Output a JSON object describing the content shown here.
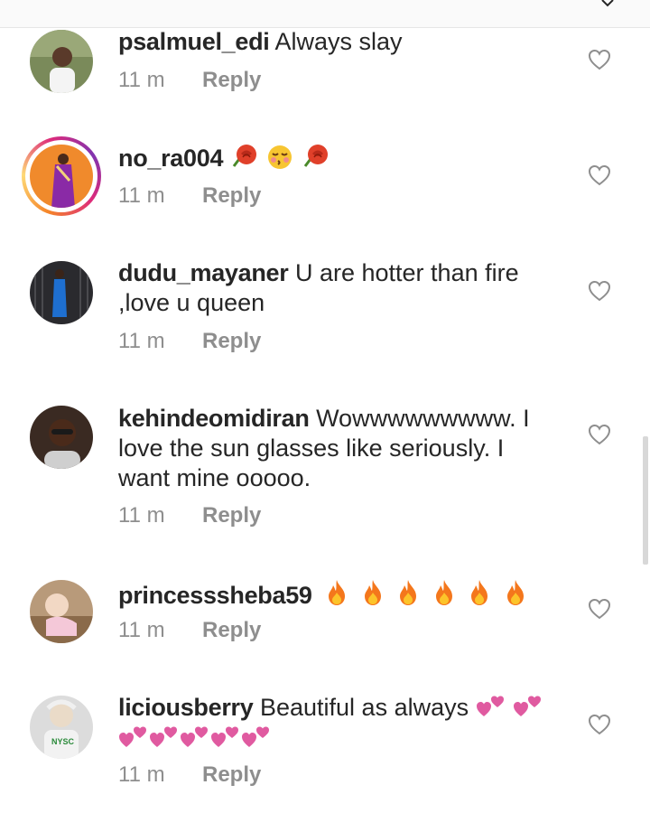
{
  "comments": [
    {
      "username": "psalmuel_edi",
      "text": "Always slay",
      "time": "11 m",
      "reply": "Reply"
    },
    {
      "username": "no_ra004",
      "text": "",
      "emojis": [
        "rose",
        "kissing-face",
        "rose"
      ],
      "time": "11 m",
      "reply": "Reply"
    },
    {
      "username": "dudu_mayaner",
      "text": "U are hotter than fire ,love u queen",
      "time": "11 m",
      "reply": "Reply"
    },
    {
      "username": "kehindeomidiran",
      "text": "Wowwwwwwwww. I love the sun glasses like seriously. I want mine ooooo.",
      "time": "11 m",
      "reply": "Reply"
    },
    {
      "username": "princesssheba59",
      "text": "",
      "emojis": [
        "fire",
        "fire",
        "fire",
        "fire",
        "fire",
        "fire"
      ],
      "time": "11 m",
      "reply": "Reply"
    },
    {
      "username": "liciousberry",
      "text": "Beautiful as always",
      "emojis": [
        "two-hearts",
        "two-hearts",
        "two-hearts",
        "two-hearts",
        "two-hearts",
        "two-hearts",
        "two-hearts"
      ],
      "time": "11 m",
      "reply": "Reply"
    }
  ],
  "colors": {
    "text": "#262626",
    "meta": "#8e8e8e",
    "heart_outline": "#8e8e8e"
  },
  "icons": {
    "like": "heart-outline-icon",
    "top": "chevron-down-icon"
  }
}
